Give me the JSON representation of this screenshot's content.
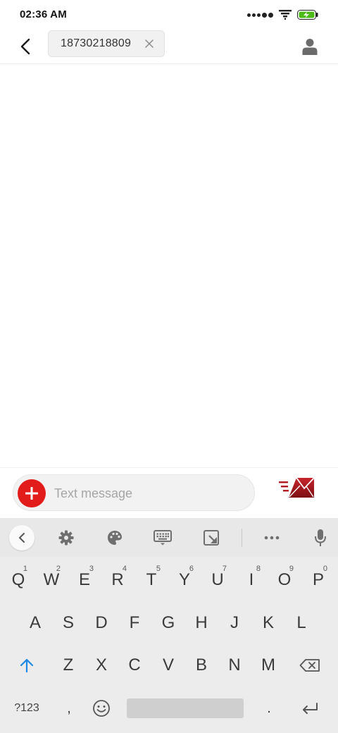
{
  "status_bar": {
    "time": "02:36 AM"
  },
  "app_bar": {
    "recipient": "18730218809"
  },
  "compose": {
    "placeholder": "Text message"
  },
  "keyboard": {
    "row1": [
      {
        "label": "Q",
        "hint": "1"
      },
      {
        "label": "W",
        "hint": "2"
      },
      {
        "label": "E",
        "hint": "3"
      },
      {
        "label": "R",
        "hint": "4"
      },
      {
        "label": "T",
        "hint": "5"
      },
      {
        "label": "Y",
        "hint": "6"
      },
      {
        "label": "U",
        "hint": "7"
      },
      {
        "label": "I",
        "hint": "8"
      },
      {
        "label": "O",
        "hint": "9"
      },
      {
        "label": "P",
        "hint": "0"
      }
    ],
    "row2": [
      "A",
      "S",
      "D",
      "F",
      "G",
      "H",
      "J",
      "K",
      "L"
    ],
    "row3": [
      "Z",
      "X",
      "C",
      "V",
      "B",
      "N",
      "M"
    ],
    "symbols_label": "?123",
    "comma": ",",
    "period": "."
  },
  "colors": {
    "accent_red": "#e21b1b",
    "shift_blue": "#1e88e5"
  }
}
